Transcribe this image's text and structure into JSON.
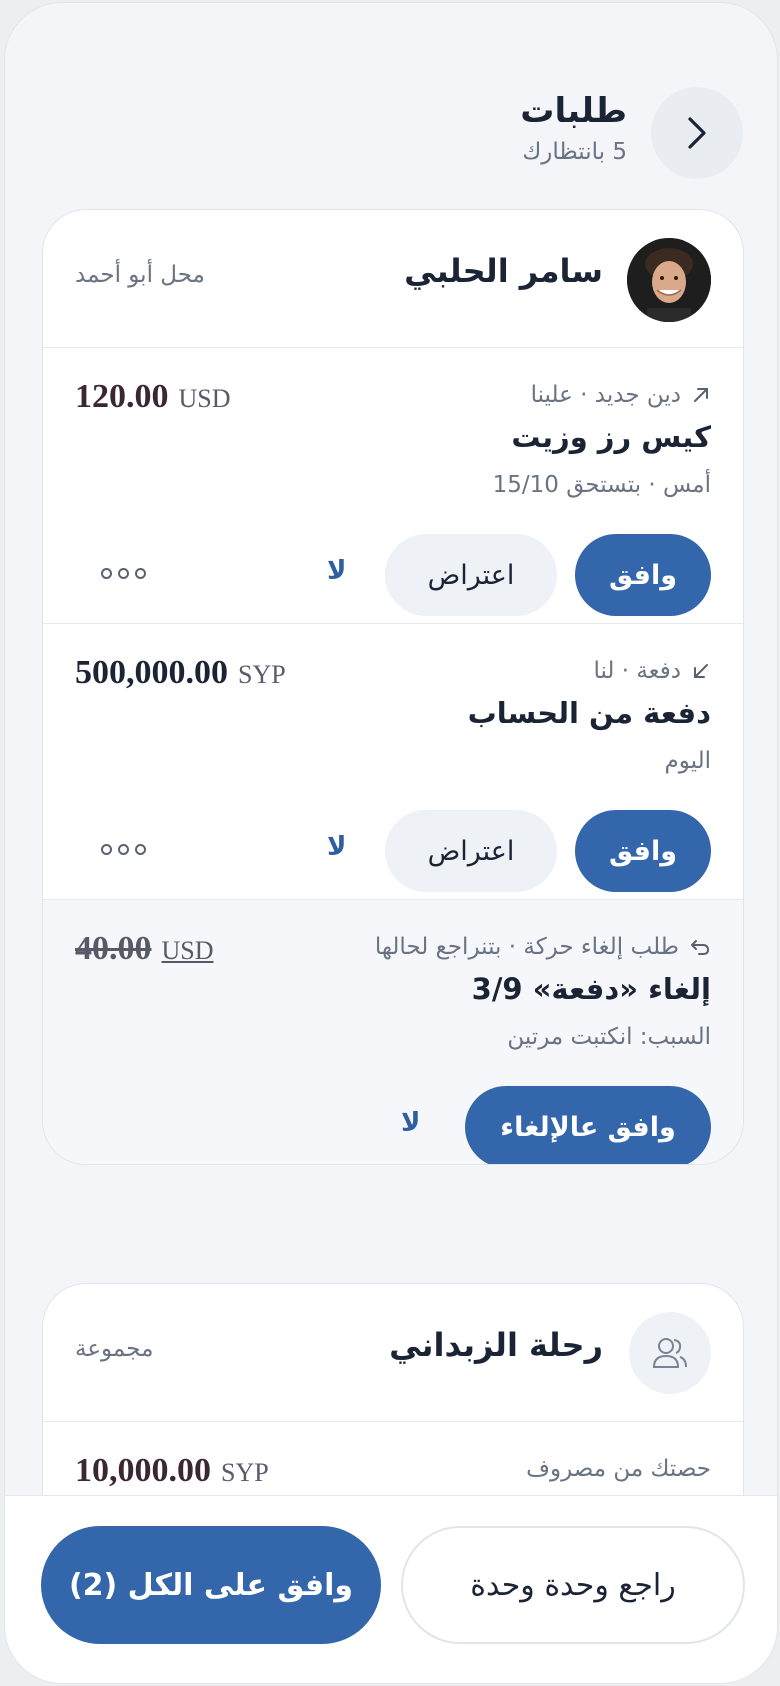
{
  "header": {
    "title": "طلبات",
    "subtitle": "5 بانتظارك"
  },
  "card1": {
    "name": "سامر الحلبي",
    "meta": "محل أبو أحمد",
    "items": [
      {
        "kind": "دين جديد · علينا",
        "title": "كيس رز وزيت",
        "sub": "أمس · بتستحق 15/10",
        "amount": "120.00",
        "currency": "USD",
        "approve": "وافق",
        "object": "اعتراض",
        "no": "لا"
      },
      {
        "kind": "دفعة · لنا",
        "title": "دفعة من الحساب",
        "sub": "اليوم",
        "amount": "500,000.00",
        "currency": "SYP",
        "approve": "وافق",
        "object": "اعتراض",
        "no": "لا"
      },
      {
        "kind": "طلب إلغاء حركة · بتنراجع لحالها",
        "title": "إلغاء «دفعة» 3/9",
        "sub": "السبب: انكتبت مرتين",
        "amount": "40.00",
        "currency": "USD",
        "approve": "وافق عالإلغاء",
        "no": "لا"
      }
    ]
  },
  "card2": {
    "name": "رحلة الزبداني",
    "meta": "مجموعة",
    "item": {
      "kind": "حصتك من مصروف",
      "amount": "10,000.00",
      "currency": "SYP"
    }
  },
  "bottom": {
    "approve_all": "وافق على الكل (2)",
    "review_one": "راجع وحدة وحدة"
  },
  "colors": {
    "primary": "#3366aa",
    "soft": "#eef1f5",
    "amount": "#3b2634"
  }
}
